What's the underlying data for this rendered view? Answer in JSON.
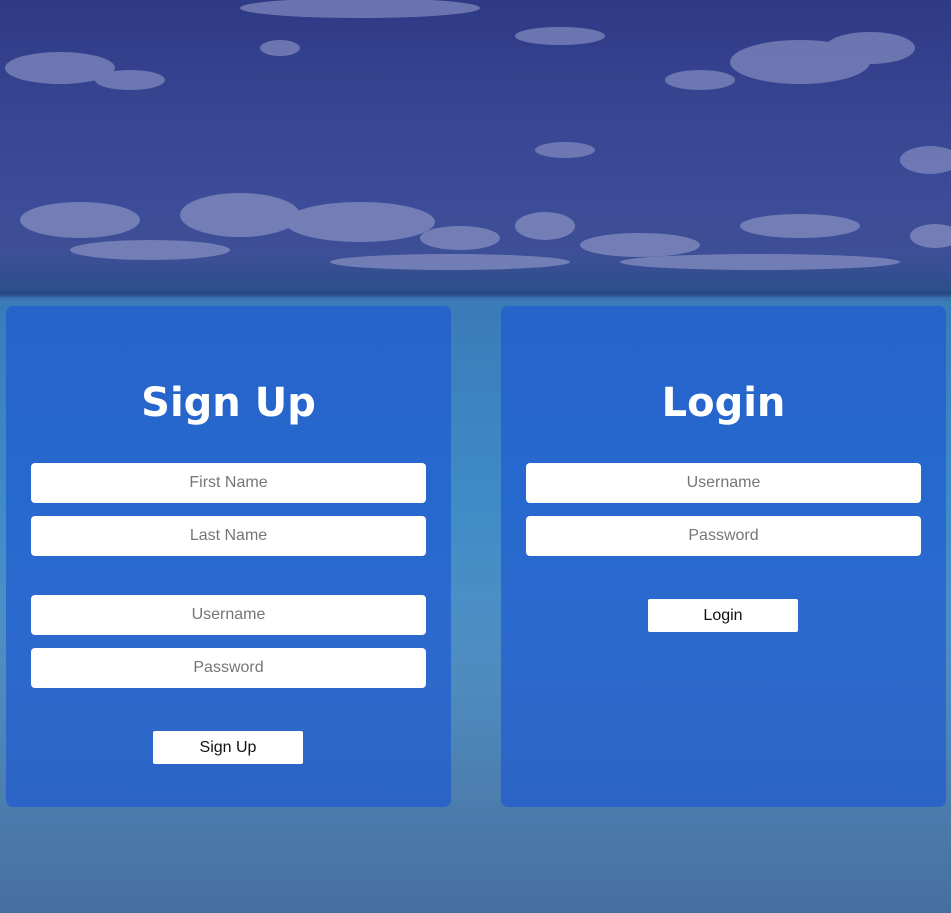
{
  "signup": {
    "title": "Sign Up",
    "fields": {
      "first_name": {
        "placeholder": "First Name",
        "value": ""
      },
      "last_name": {
        "placeholder": "Last Name",
        "value": ""
      },
      "username": {
        "placeholder": "Username",
        "value": ""
      },
      "password": {
        "placeholder": "Password",
        "value": ""
      }
    },
    "button_label": "Sign Up"
  },
  "login": {
    "title": "Login",
    "fields": {
      "username": {
        "placeholder": "Username",
        "value": ""
      },
      "password": {
        "placeholder": "Password",
        "value": ""
      }
    },
    "button_label": "Login"
  },
  "colors": {
    "panel": "#1c58d2",
    "sky": "#374592",
    "water": "#3d8bc7"
  }
}
